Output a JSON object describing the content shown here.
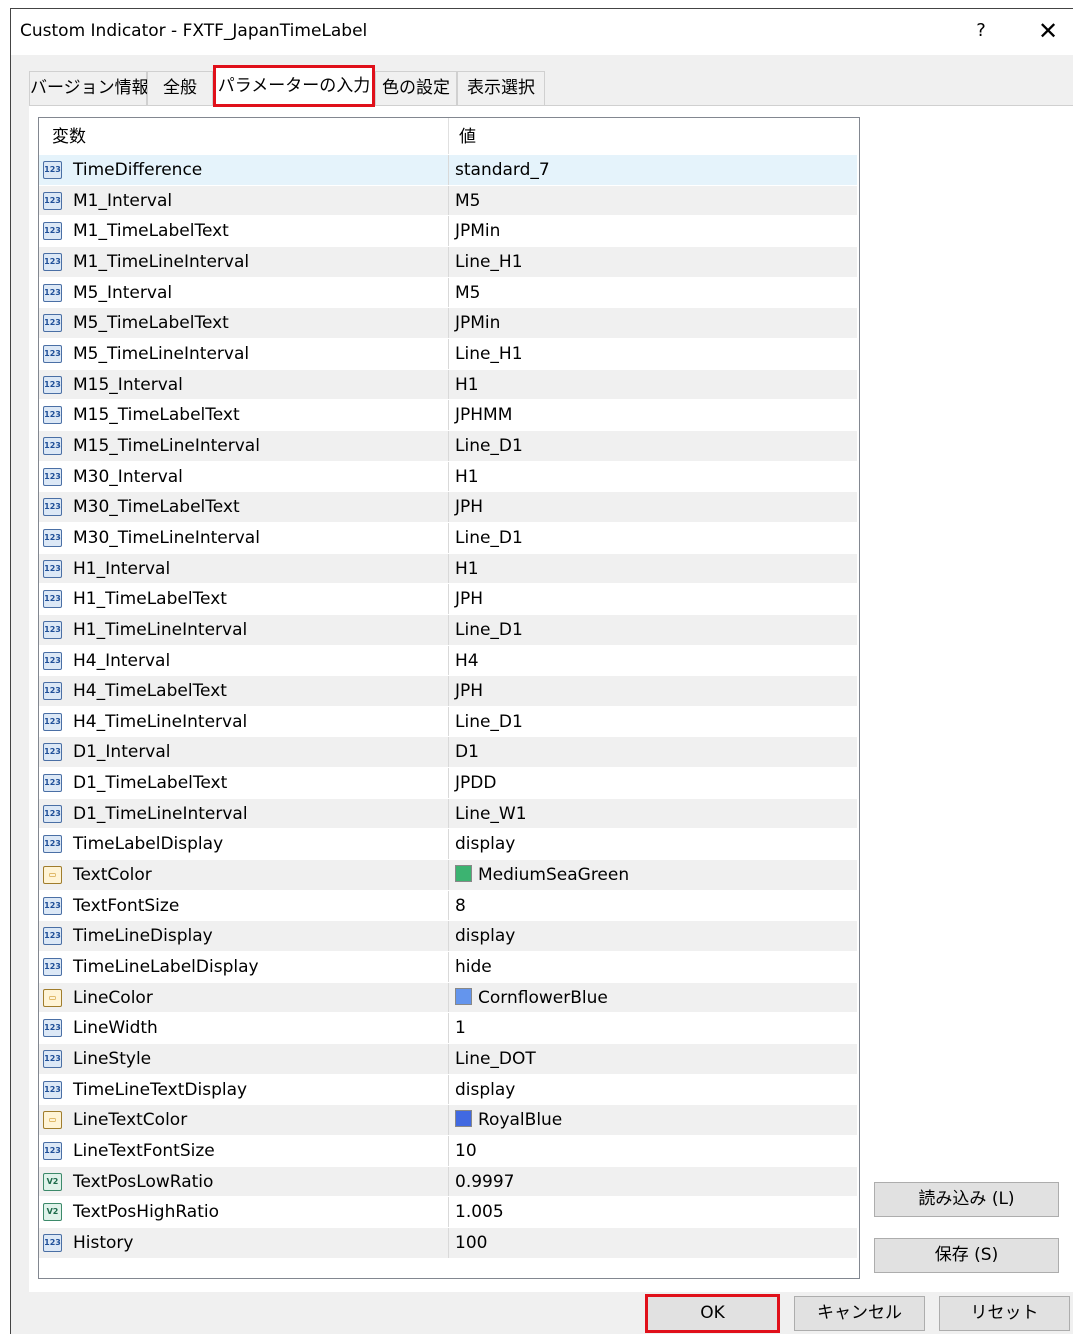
{
  "window": {
    "title": "Custom Indicator - FXTF_JapanTimeLabel",
    "help_label": "?",
    "close_label": "✕"
  },
  "tabs": [
    {
      "label": "バージョン情報"
    },
    {
      "label": "全般"
    },
    {
      "label": "パラメーターの入力"
    },
    {
      "label": "色の設定"
    },
    {
      "label": "表示選択"
    }
  ],
  "grid": {
    "headers": {
      "name": "変数",
      "value": "値"
    },
    "rows": [
      {
        "name": "TimeDifference",
        "value": "standard_7",
        "type": "int"
      },
      {
        "name": "M1_Interval",
        "value": "M5",
        "type": "int"
      },
      {
        "name": "M1_TimeLabelText",
        "value": "JPMin",
        "type": "int"
      },
      {
        "name": "M1_TimeLineInterval",
        "value": "Line_H1",
        "type": "int"
      },
      {
        "name": "M5_Interval",
        "value": "M5",
        "type": "int"
      },
      {
        "name": "M5_TimeLabelText",
        "value": "JPMin",
        "type": "int"
      },
      {
        "name": "M5_TimeLineInterval",
        "value": "Line_H1",
        "type": "int"
      },
      {
        "name": "M15_Interval",
        "value": "H1",
        "type": "int"
      },
      {
        "name": "M15_TimeLabelText",
        "value": "JPHMM",
        "type": "int"
      },
      {
        "name": "M15_TimeLineInterval",
        "value": "Line_D1",
        "type": "int"
      },
      {
        "name": "M30_Interval",
        "value": "H1",
        "type": "int"
      },
      {
        "name": "M30_TimeLabelText",
        "value": "JPH",
        "type": "int"
      },
      {
        "name": "M30_TimeLineInterval",
        "value": "Line_D1",
        "type": "int"
      },
      {
        "name": "H1_Interval",
        "value": "H1",
        "type": "int"
      },
      {
        "name": "H1_TimeLabelText",
        "value": "JPH",
        "type": "int"
      },
      {
        "name": "H1_TimeLineInterval",
        "value": "Line_D1",
        "type": "int"
      },
      {
        "name": "H4_Interval",
        "value": "H4",
        "type": "int"
      },
      {
        "name": "H4_TimeLabelText",
        "value": "JPH",
        "type": "int"
      },
      {
        "name": "H4_TimeLineInterval",
        "value": "Line_D1",
        "type": "int"
      },
      {
        "name": "D1_Interval",
        "value": "D1",
        "type": "int"
      },
      {
        "name": "D1_TimeLabelText",
        "value": "JPDD",
        "type": "int"
      },
      {
        "name": "D1_TimeLineInterval",
        "value": "Line_W1",
        "type": "int"
      },
      {
        "name": "TimeLabelDisplay",
        "value": "display",
        "type": "int"
      },
      {
        "name": "TextColor",
        "value": "MediumSeaGreen",
        "type": "color",
        "color": "#3cb371"
      },
      {
        "name": "TextFontSize",
        "value": "8",
        "type": "int"
      },
      {
        "name": "TimeLineDisplay",
        "value": "display",
        "type": "int"
      },
      {
        "name": "TimeLineLabelDisplay",
        "value": "hide",
        "type": "int"
      },
      {
        "name": "LineColor",
        "value": "CornflowerBlue",
        "type": "color",
        "color": "#6495ed"
      },
      {
        "name": "LineWidth",
        "value": "1",
        "type": "int"
      },
      {
        "name": "LineStyle",
        "value": "Line_DOT",
        "type": "int"
      },
      {
        "name": "TimeLineTextDisplay",
        "value": "display",
        "type": "int"
      },
      {
        "name": "LineTextColor",
        "value": "RoyalBlue",
        "type": "color",
        "color": "#4169e1"
      },
      {
        "name": "LineTextFontSize",
        "value": "10",
        "type": "int"
      },
      {
        "name": "TextPosLowRatio",
        "value": "0.9997",
        "type": "double"
      },
      {
        "name": "TextPosHighRatio",
        "value": "1.005",
        "type": "double"
      },
      {
        "name": "History",
        "value": "100",
        "type": "int"
      }
    ]
  },
  "buttons": {
    "load": "読み込み (L)",
    "save": "保存 (S)",
    "ok": "OK",
    "cancel": "キャンセル",
    "reset": "リセット"
  },
  "icons": {
    "int": "123",
    "double": "V2",
    "color": "▭"
  },
  "colors": {
    "highlight_outline": "#e0101a",
    "selected_row": "#e5f3fb"
  }
}
